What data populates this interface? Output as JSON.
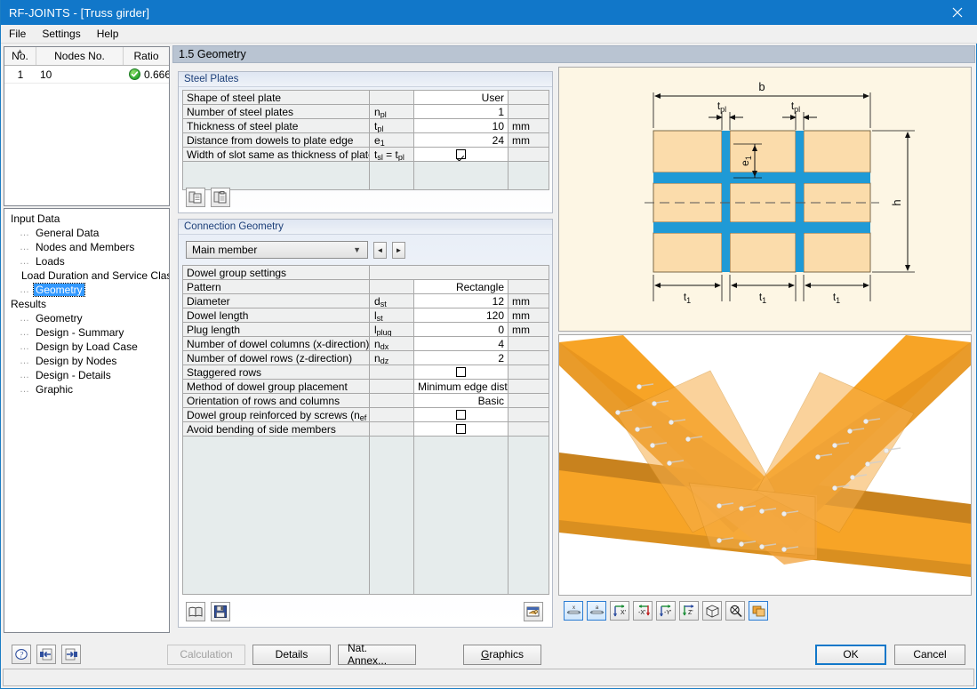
{
  "window": {
    "title": "RF-JOINTS - [Truss girder]",
    "close_label": "close-icon",
    "accent": "#1177c9"
  },
  "menu": {
    "items": [
      "File",
      "Settings",
      "Help"
    ]
  },
  "node_grid": {
    "columns": [
      "No.",
      "Nodes No.",
      "Ratio"
    ],
    "rows": [
      {
        "no": "1",
        "nodes": "10",
        "ratio": "0.666",
        "status": "ok"
      }
    ]
  },
  "tree": {
    "groups": [
      {
        "label": "Input Data",
        "items": [
          {
            "label": "General Data",
            "selected": false
          },
          {
            "label": "Nodes and Members",
            "selected": false
          },
          {
            "label": "Loads",
            "selected": false
          },
          {
            "label": "Load Duration and Service Class",
            "selected": false
          },
          {
            "label": "Geometry",
            "selected": true
          }
        ]
      },
      {
        "label": "Results",
        "items": [
          {
            "label": "Geometry",
            "selected": false
          },
          {
            "label": "Design - Summary",
            "selected": false
          },
          {
            "label": "Design by Load Case",
            "selected": false
          },
          {
            "label": "Design by Nodes",
            "selected": false
          },
          {
            "label": "Design - Details",
            "selected": false
          },
          {
            "label": "Graphic",
            "selected": false
          }
        ]
      }
    ]
  },
  "section": {
    "title": "1.5 Geometry"
  },
  "steel_plates": {
    "header": "Steel Plates",
    "rows": [
      {
        "label": "Shape of steel plate",
        "sym": "",
        "sym_sub": "",
        "value": "User",
        "align": "right",
        "unit": "",
        "type": "text"
      },
      {
        "label": "Number of steel plates",
        "sym": "n",
        "sym_sub": "pl",
        "value": "1",
        "align": "right",
        "unit": "",
        "type": "text"
      },
      {
        "label": "Thickness of steel plate",
        "sym": "t",
        "sym_sub": "pl",
        "value": "10",
        "align": "right",
        "unit": "mm",
        "type": "text"
      },
      {
        "label": "Distance from dowels to plate edge",
        "sym": "e",
        "sym_sub": "1",
        "value": "24",
        "align": "right",
        "unit": "mm",
        "type": "text"
      },
      {
        "label": "Width of slot same as thickness of plate",
        "sym": "t_sl = t_pl",
        "sym_sub": "",
        "value": "checked",
        "align": "center",
        "unit": "",
        "type": "checkbox"
      }
    ],
    "toolbar": [
      {
        "name": "copy-plate-button",
        "title": "Copy"
      },
      {
        "name": "paste-plate-button",
        "title": "Paste"
      }
    ]
  },
  "connection_geometry": {
    "header": "Connection Geometry",
    "member_select": {
      "value": "Main member",
      "options": [
        "Main member"
      ]
    },
    "prev_label": "◄",
    "next_label": "►",
    "rows": [
      {
        "label": "Dowel group settings",
        "sym": "",
        "sym_sub": "",
        "value": "",
        "align": "right",
        "unit": "",
        "type": "group"
      },
      {
        "label": "Pattern",
        "sym": "",
        "sym_sub": "",
        "value": "Rectangle",
        "align": "right",
        "unit": "",
        "type": "text"
      },
      {
        "label": "Diameter",
        "sym": "d",
        "sym_sub": "st",
        "value": "12",
        "align": "right",
        "unit": "mm",
        "type": "text"
      },
      {
        "label": "Dowel length",
        "sym": "l",
        "sym_sub": "st",
        "value": "120",
        "align": "right",
        "unit": "mm",
        "type": "text"
      },
      {
        "label": "Plug length",
        "sym": "l",
        "sym_sub": "plug",
        "value": "0",
        "align": "right",
        "unit": "mm",
        "type": "text"
      },
      {
        "label": "Number of dowel columns (x-direction)",
        "sym": "n",
        "sym_sub": "dx",
        "value": "4",
        "align": "right",
        "unit": "",
        "type": "text"
      },
      {
        "label": "Number of dowel rows (z-direction)",
        "sym": "n",
        "sym_sub": "dz",
        "value": "2",
        "align": "right",
        "unit": "",
        "type": "text"
      },
      {
        "label": "Staggered rows",
        "sym": "",
        "sym_sub": "",
        "value": "unchecked",
        "align": "center",
        "unit": "",
        "type": "checkbox"
      },
      {
        "label": "Method of dowel group placement",
        "sym": "",
        "sym_sub": "",
        "value": "Minimum edge distan",
        "align": "right",
        "unit": "",
        "type": "text"
      },
      {
        "label": "Orientation of rows and columns",
        "sym": "",
        "sym_sub": "",
        "value": "Basic",
        "align": "right",
        "unit": "",
        "type": "text"
      },
      {
        "label": "Dowel group reinforced by screws (n_ef = n)",
        "sym": "",
        "sym_sub": "",
        "value": "unchecked",
        "align": "center",
        "unit": "",
        "type": "checkbox"
      },
      {
        "label": "Avoid bending of side members",
        "sym": "",
        "sym_sub": "",
        "value": "unchecked",
        "align": "center",
        "unit": "",
        "type": "checkbox"
      }
    ],
    "toolbar": [
      {
        "name": "library-button",
        "title": "Library"
      },
      {
        "name": "save-button",
        "title": "Save"
      },
      {
        "name": "settings-button",
        "title": "Settings"
      }
    ]
  },
  "diagram": {
    "labels": {
      "b": "b",
      "t_pl_left": "t",
      "t_pl_left_sub": "pl",
      "t_pl_right": "t",
      "t_pl_right_sub": "pl",
      "e1": "e",
      "e1_sub": "1",
      "h": "h",
      "t1_a": "t",
      "t1_a_sub": "1",
      "t1_b": "t",
      "t1_b_sub": "1",
      "t1_c": "t",
      "t1_c_sub": "1"
    },
    "colors": {
      "timber": "#fbdcab",
      "steel": "#1f9ad6",
      "background": "#fdf6e3"
    }
  },
  "render": {
    "colors": {
      "member": "#f7a426",
      "member_dark": "#c8821e",
      "plate": "#f0982a",
      "dowel": "#e8e8e8"
    },
    "toolbar": [
      {
        "name": "render-wireframe-button",
        "label": "x",
        "selected": true
      },
      {
        "name": "render-solid-button",
        "label": "a",
        "selected": true
      },
      {
        "name": "view-x-button",
        "label": "X",
        "selected": false
      },
      {
        "name": "view-neg-x-button",
        "label": "-X",
        "selected": false
      },
      {
        "name": "view-y-button",
        "label": "-Y",
        "selected": false
      },
      {
        "name": "view-z-button",
        "label": "Z",
        "selected": false
      },
      {
        "name": "view-iso-button",
        "label": "",
        "selected": false
      },
      {
        "name": "zoom-all-button",
        "label": "",
        "selected": false
      },
      {
        "name": "print-graphic-button",
        "label": "",
        "selected": true
      }
    ]
  },
  "bottom": {
    "help_label": "?",
    "prev_label": "←",
    "next_label": "→",
    "calculation": "Calculation",
    "details": "Details",
    "nat_annex": "Nat. Annex...",
    "graphics": "Graphics",
    "graphics_accesskey": "G",
    "ok": "OK",
    "cancel": "Cancel"
  }
}
